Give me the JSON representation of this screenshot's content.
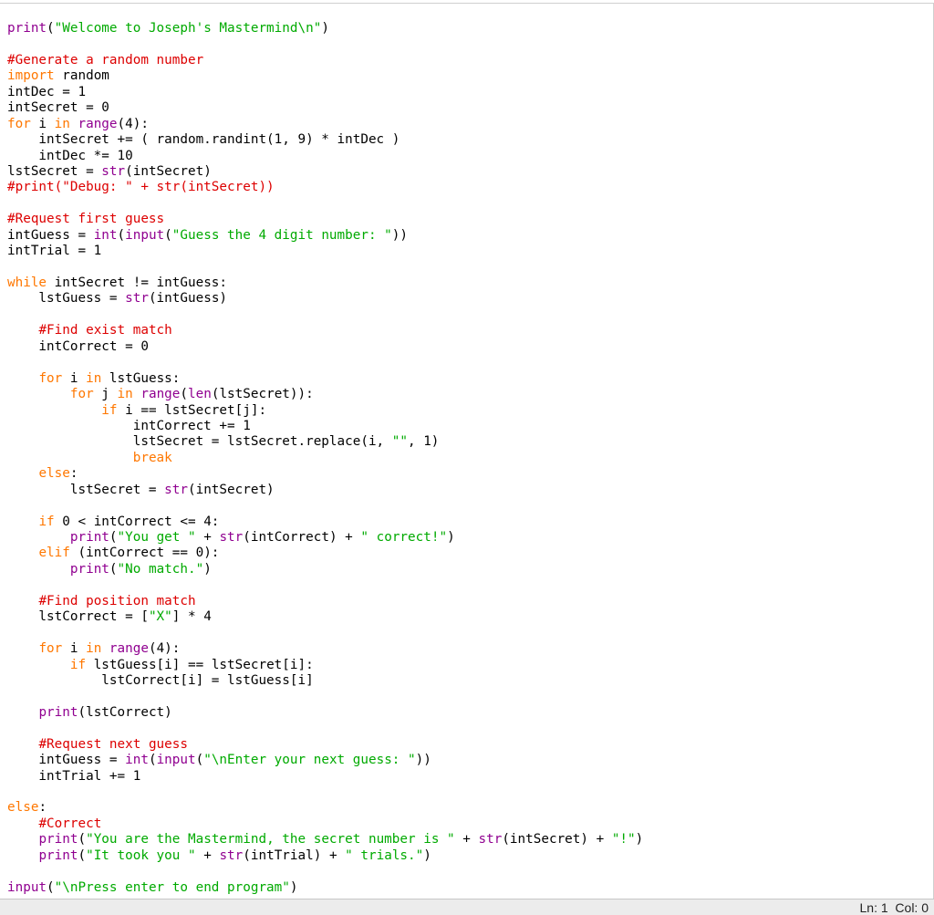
{
  "editor": {
    "lines": [
      [
        {
          "t": "print",
          "c": "bi"
        },
        {
          "t": "(",
          "c": "pl"
        },
        {
          "t": "\"Welcome to Joseph's Mastermind\\n\"",
          "c": "str"
        },
        {
          "t": ")",
          "c": "pl"
        }
      ],
      [],
      [
        {
          "t": "#Generate a random number",
          "c": "cm"
        }
      ],
      [
        {
          "t": "import",
          "c": "kw"
        },
        {
          "t": " random",
          "c": "pl"
        }
      ],
      [
        {
          "t": "intDec = 1",
          "c": "pl"
        }
      ],
      [
        {
          "t": "intSecret = 0",
          "c": "pl"
        }
      ],
      [
        {
          "t": "for",
          "c": "kw"
        },
        {
          "t": " i ",
          "c": "pl"
        },
        {
          "t": "in",
          "c": "kw"
        },
        {
          "t": " ",
          "c": "pl"
        },
        {
          "t": "range",
          "c": "bi"
        },
        {
          "t": "(4):",
          "c": "pl"
        }
      ],
      [
        {
          "t": "    intSecret += ( random.randint(1, 9) * intDec )",
          "c": "pl"
        }
      ],
      [
        {
          "t": "    intDec *= 10",
          "c": "pl"
        }
      ],
      [
        {
          "t": "lstSecret = ",
          "c": "pl"
        },
        {
          "t": "str",
          "c": "bi"
        },
        {
          "t": "(intSecret)",
          "c": "pl"
        }
      ],
      [
        {
          "t": "#print(\"Debug: \" + str(intSecret))",
          "c": "cm"
        }
      ],
      [],
      [
        {
          "t": "#Request first guess",
          "c": "cm"
        }
      ],
      [
        {
          "t": "intGuess = ",
          "c": "pl"
        },
        {
          "t": "int",
          "c": "bi"
        },
        {
          "t": "(",
          "c": "pl"
        },
        {
          "t": "input",
          "c": "bi"
        },
        {
          "t": "(",
          "c": "pl"
        },
        {
          "t": "\"Guess the 4 digit number: \"",
          "c": "str"
        },
        {
          "t": "))",
          "c": "pl"
        }
      ],
      [
        {
          "t": "intTrial = 1",
          "c": "pl"
        }
      ],
      [],
      [
        {
          "t": "while",
          "c": "kw"
        },
        {
          "t": " intSecret != intGuess:",
          "c": "pl"
        }
      ],
      [
        {
          "t": "    lstGuess = ",
          "c": "pl"
        },
        {
          "t": "str",
          "c": "bi"
        },
        {
          "t": "(intGuess)",
          "c": "pl"
        }
      ],
      [],
      [
        {
          "t": "    ",
          "c": "pl"
        },
        {
          "t": "#Find exist match",
          "c": "cm"
        }
      ],
      [
        {
          "t": "    intCorrect = 0",
          "c": "pl"
        }
      ],
      [],
      [
        {
          "t": "    ",
          "c": "pl"
        },
        {
          "t": "for",
          "c": "kw"
        },
        {
          "t": " i ",
          "c": "pl"
        },
        {
          "t": "in",
          "c": "kw"
        },
        {
          "t": " lstGuess:",
          "c": "pl"
        }
      ],
      [
        {
          "t": "        ",
          "c": "pl"
        },
        {
          "t": "for",
          "c": "kw"
        },
        {
          "t": " j ",
          "c": "pl"
        },
        {
          "t": "in",
          "c": "kw"
        },
        {
          "t": " ",
          "c": "pl"
        },
        {
          "t": "range",
          "c": "bi"
        },
        {
          "t": "(",
          "c": "pl"
        },
        {
          "t": "len",
          "c": "bi"
        },
        {
          "t": "(lstSecret)):",
          "c": "pl"
        }
      ],
      [
        {
          "t": "            ",
          "c": "pl"
        },
        {
          "t": "if",
          "c": "kw"
        },
        {
          "t": " i == lstSecret[j]:",
          "c": "pl"
        }
      ],
      [
        {
          "t": "                intCorrect += 1",
          "c": "pl"
        }
      ],
      [
        {
          "t": "                lstSecret = lstSecret.replace(i, ",
          "c": "pl"
        },
        {
          "t": "\"\"",
          "c": "str"
        },
        {
          "t": ", 1)",
          "c": "pl"
        }
      ],
      [
        {
          "t": "                ",
          "c": "pl"
        },
        {
          "t": "break",
          "c": "kw"
        }
      ],
      [
        {
          "t": "    ",
          "c": "pl"
        },
        {
          "t": "else",
          "c": "kw"
        },
        {
          "t": ":",
          "c": "pl"
        }
      ],
      [
        {
          "t": "        lstSecret = ",
          "c": "pl"
        },
        {
          "t": "str",
          "c": "bi"
        },
        {
          "t": "(intSecret)",
          "c": "pl"
        }
      ],
      [],
      [
        {
          "t": "    ",
          "c": "pl"
        },
        {
          "t": "if",
          "c": "kw"
        },
        {
          "t": " 0 < intCorrect <= 4:",
          "c": "pl"
        }
      ],
      [
        {
          "t": "        ",
          "c": "pl"
        },
        {
          "t": "print",
          "c": "bi"
        },
        {
          "t": "(",
          "c": "pl"
        },
        {
          "t": "\"You get \"",
          "c": "str"
        },
        {
          "t": " + ",
          "c": "pl"
        },
        {
          "t": "str",
          "c": "bi"
        },
        {
          "t": "(intCorrect) + ",
          "c": "pl"
        },
        {
          "t": "\" correct!\"",
          "c": "str"
        },
        {
          "t": ")",
          "c": "pl"
        }
      ],
      [
        {
          "t": "    ",
          "c": "pl"
        },
        {
          "t": "elif",
          "c": "kw"
        },
        {
          "t": " (intCorrect == 0):",
          "c": "pl"
        }
      ],
      [
        {
          "t": "        ",
          "c": "pl"
        },
        {
          "t": "print",
          "c": "bi"
        },
        {
          "t": "(",
          "c": "pl"
        },
        {
          "t": "\"No match.\"",
          "c": "str"
        },
        {
          "t": ")",
          "c": "pl"
        }
      ],
      [],
      [
        {
          "t": "    ",
          "c": "pl"
        },
        {
          "t": "#Find position match",
          "c": "cm"
        }
      ],
      [
        {
          "t": "    lstCorrect = [",
          "c": "pl"
        },
        {
          "t": "\"X\"",
          "c": "str"
        },
        {
          "t": "] * 4",
          "c": "pl"
        }
      ],
      [],
      [
        {
          "t": "    ",
          "c": "pl"
        },
        {
          "t": "for",
          "c": "kw"
        },
        {
          "t": " i ",
          "c": "pl"
        },
        {
          "t": "in",
          "c": "kw"
        },
        {
          "t": " ",
          "c": "pl"
        },
        {
          "t": "range",
          "c": "bi"
        },
        {
          "t": "(4):",
          "c": "pl"
        }
      ],
      [
        {
          "t": "        ",
          "c": "pl"
        },
        {
          "t": "if",
          "c": "kw"
        },
        {
          "t": " lstGuess[i] == lstSecret[i]:",
          "c": "pl"
        }
      ],
      [
        {
          "t": "            lstCorrect[i] = lstGuess[i]",
          "c": "pl"
        }
      ],
      [],
      [
        {
          "t": "    ",
          "c": "pl"
        },
        {
          "t": "print",
          "c": "bi"
        },
        {
          "t": "(lstCorrect)",
          "c": "pl"
        }
      ],
      [],
      [
        {
          "t": "    ",
          "c": "pl"
        },
        {
          "t": "#Request next guess",
          "c": "cm"
        }
      ],
      [
        {
          "t": "    intGuess = ",
          "c": "pl"
        },
        {
          "t": "int",
          "c": "bi"
        },
        {
          "t": "(",
          "c": "pl"
        },
        {
          "t": "input",
          "c": "bi"
        },
        {
          "t": "(",
          "c": "pl"
        },
        {
          "t": "\"\\nEnter your next guess: \"",
          "c": "str"
        },
        {
          "t": "))",
          "c": "pl"
        }
      ],
      [
        {
          "t": "    intTrial += 1",
          "c": "pl"
        }
      ],
      [],
      [
        {
          "t": "else",
          "c": "kw"
        },
        {
          "t": ":",
          "c": "pl"
        }
      ],
      [
        {
          "t": "    ",
          "c": "pl"
        },
        {
          "t": "#Correct",
          "c": "cm"
        }
      ],
      [
        {
          "t": "    ",
          "c": "pl"
        },
        {
          "t": "print",
          "c": "bi"
        },
        {
          "t": "(",
          "c": "pl"
        },
        {
          "t": "\"You are the Mastermind, the secret number is \"",
          "c": "str"
        },
        {
          "t": " + ",
          "c": "pl"
        },
        {
          "t": "str",
          "c": "bi"
        },
        {
          "t": "(intSecret) + ",
          "c": "pl"
        },
        {
          "t": "\"!\"",
          "c": "str"
        },
        {
          "t": ")",
          "c": "pl"
        }
      ],
      [
        {
          "t": "    ",
          "c": "pl"
        },
        {
          "t": "print",
          "c": "bi"
        },
        {
          "t": "(",
          "c": "pl"
        },
        {
          "t": "\"It took you \"",
          "c": "str"
        },
        {
          "t": " + ",
          "c": "pl"
        },
        {
          "t": "str",
          "c": "bi"
        },
        {
          "t": "(intTrial) + ",
          "c": "pl"
        },
        {
          "t": "\" trials.\"",
          "c": "str"
        },
        {
          "t": ")",
          "c": "pl"
        }
      ],
      [],
      [
        {
          "t": "input",
          "c": "bi"
        },
        {
          "t": "(",
          "c": "pl"
        },
        {
          "t": "\"\\nPress enter to end program\"",
          "c": "str"
        },
        {
          "t": ")",
          "c": "pl"
        }
      ]
    ]
  },
  "statusbar": {
    "position": "Ln: 1  Col: 0"
  },
  "colors": {
    "keyword": "#ff7700",
    "builtin": "#900090",
    "string": "#00aa00",
    "comment": "#dd0000",
    "plain": "#000000"
  }
}
